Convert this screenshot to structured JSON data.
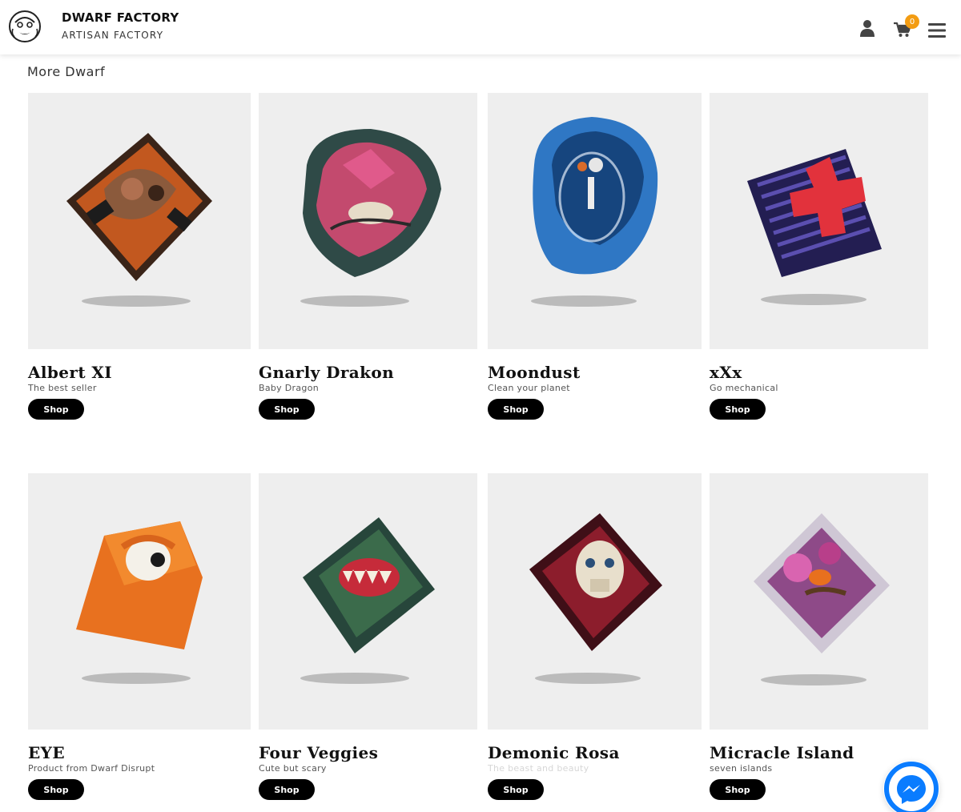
{
  "header": {
    "brand_title": "DWARF FACTORY",
    "brand_subtitle": "ARTISAN FACTORY",
    "cart_count": "0",
    "logo_icon": "dwarf-face-logo",
    "user_icon": "user-icon",
    "cart_icon": "cart-icon",
    "menu_icon": "hamburger-menu-icon",
    "badge_color": "#f39c12"
  },
  "section": {
    "title": "More Dwarf"
  },
  "products": [
    {
      "name": "Albert XI",
      "tagline": "The best seller",
      "button": "Shop"
    },
    {
      "name": "Gnarly Drakon",
      "tagline": "Baby Dragon",
      "button": "Shop"
    },
    {
      "name": "Moondust",
      "tagline": "Clean your planet",
      "button": "Shop"
    },
    {
      "name": "xXx",
      "tagline": "Go mechanical",
      "button": "Shop"
    },
    {
      "name": "EYE",
      "tagline": "Product from Dwarf  Disrupt",
      "button": "Shop"
    },
    {
      "name": "Four Veggies",
      "tagline": "Cute but scary",
      "button": "Shop"
    },
    {
      "name": "Demonic Rosa",
      "tagline": "The beast and beauty",
      "button": "Shop"
    },
    {
      "name": "Micracle Island",
      "tagline": "seven islands",
      "button": "Shop"
    }
  ],
  "chat": {
    "icon": "messenger-icon",
    "color": "#0a7cff"
  }
}
